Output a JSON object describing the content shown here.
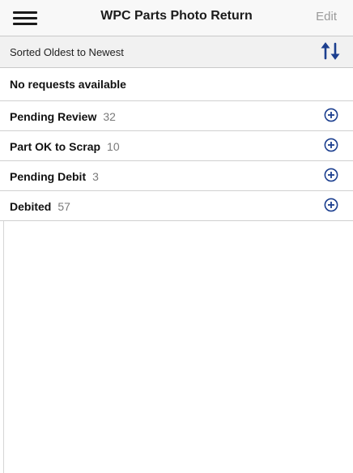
{
  "nav": {
    "title": "WPC Parts Photo Return",
    "edit_label": "Edit",
    "menu_icon": "hamburger-icon"
  },
  "sort": {
    "label": "Sorted Oldest to Newest",
    "icon": "sort-arrows-icon"
  },
  "empty": {
    "message": "No requests available"
  },
  "sections": [
    {
      "label": "Pending Review",
      "count": "32"
    },
    {
      "label": "Part OK to Scrap",
      "count": "10"
    },
    {
      "label": "Pending Debit",
      "count": "3"
    },
    {
      "label": "Debited",
      "count": "57"
    }
  ],
  "colors": {
    "accent": "#1c3f8f",
    "muted": "#9a9a9a"
  }
}
